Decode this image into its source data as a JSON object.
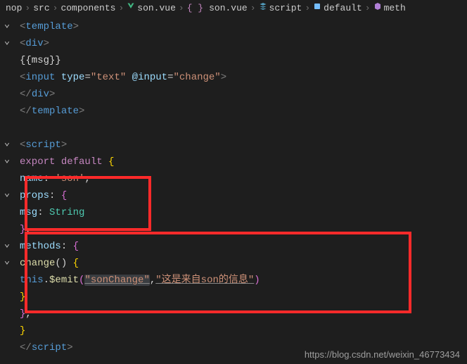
{
  "breadcrumbs": {
    "b0": "nop",
    "b1": "src",
    "b2": "components",
    "b3": "son.vue",
    "b4": "son.vue",
    "b5": "script",
    "b6": "default",
    "b7": "meth"
  },
  "code": {
    "sep": "›",
    "lt": "<",
    "gt": ">",
    "ltSlash": "</",
    "slashGt": "/>",
    "template": "template",
    "div": "div",
    "input": "input",
    "script": "script",
    "msgExpr": "{{msg}}",
    "typeAttr": "type",
    "textVal": "\"text\"",
    "inputEvt": "@input",
    "changeVal": "\"change\"",
    "export": "export",
    "default": "default",
    "openBrace": "{",
    "closeBrace": "}",
    "name": "name",
    "son": "'son'",
    "props": "props",
    "msg": "msg",
    "String": "String",
    "methods": "methods",
    "change": "change",
    "paren": "()",
    "this": "this",
    "emit": "$emit",
    "sonChange": "\"sonChange\"",
    "emitMsg": "\"这是来自son的信息\"",
    "comma": ",",
    "colon": ":",
    "dot": ".",
    "eq": "=",
    "sp": " ",
    "openParen": "(",
    "closeParen": ")"
  },
  "watermark": "https://blog.csdn.net/weixin_46773434"
}
